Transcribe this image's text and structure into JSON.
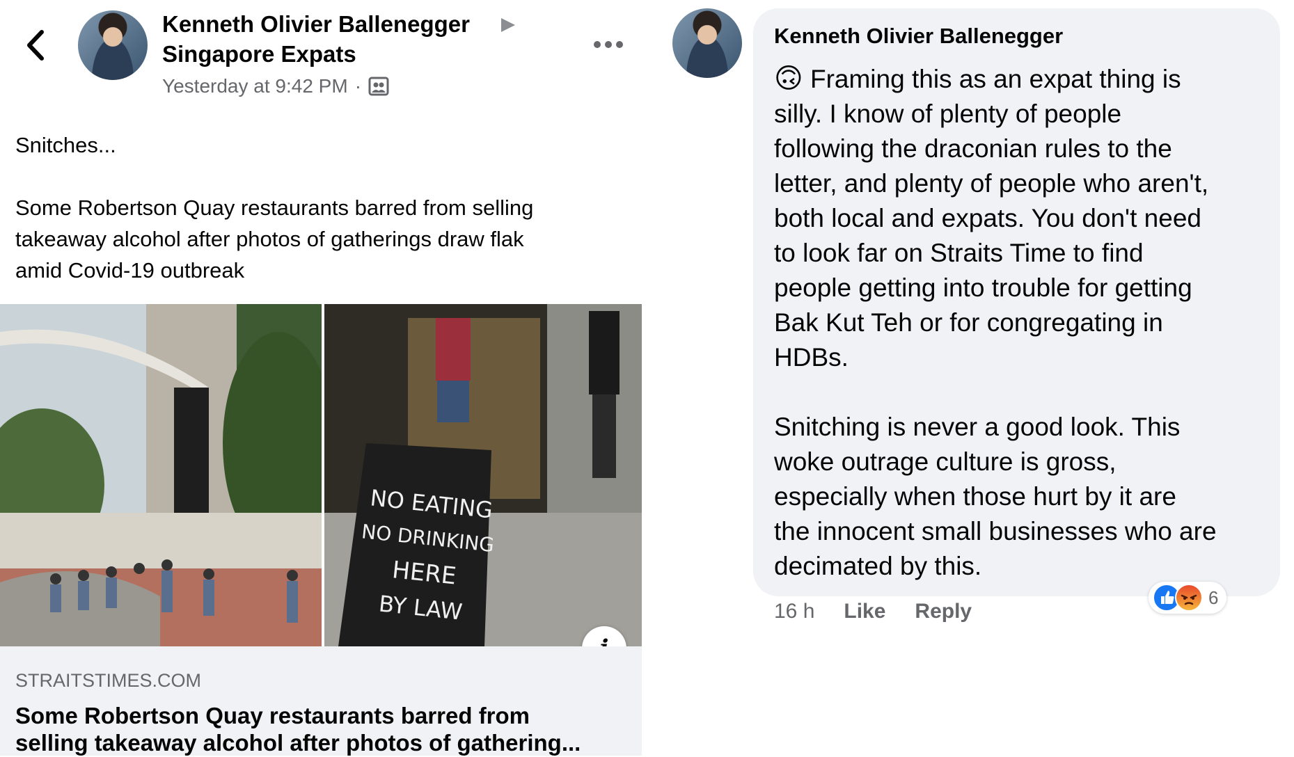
{
  "post": {
    "author": "Kenneth Olivier Ballenegger",
    "group": "Singapore Expats",
    "timestamp": "Yesterday at 9:42 PM",
    "separator": "·",
    "text_line1": "Snitches...",
    "text_lines": [
      "Some Robertson Quay restaurants barred from selling",
      "takeaway alcohol after photos of gatherings draw flak",
      "amid Covid-19 outbreak"
    ],
    "sign_lines": [
      "NO EATING",
      "NO DRINKING",
      "HERE",
      "BY LAW"
    ],
    "info_glyph": "i",
    "link": {
      "domain": "STRAITSTIMES.COM",
      "title_lines": [
        "Some Robertson Quay restaurants barred from",
        "selling takeaway alcohol after photos of gathering..."
      ]
    },
    "icons": {
      "back": "back-chevron-icon",
      "arrow": "right-triangle-icon",
      "more": "more-options-icon",
      "audience": "group-audience-icon",
      "info": "info-icon"
    }
  },
  "comment": {
    "author": "Kenneth Olivier Ballenegger",
    "emoji": "🙃",
    "paragraph1_lines": [
      "Framing this as an expat thing is",
      "silly. I know of plenty of people",
      "following the draconian rules to the",
      "letter, and plenty of people who aren't,",
      "both local and expats. You don't need",
      "to look far on Straits Time to find",
      "people getting into trouble for getting",
      "Bak Kut Teh or for congregating in",
      "HDBs."
    ],
    "paragraph2_lines": [
      "Snitching is never a good look. This",
      "woke outrage culture is gross,",
      "especially when those hurt by it are",
      "the innocent small businesses who are",
      "decimated by this."
    ],
    "time": "16 h",
    "like_label": "Like",
    "reply_label": "Reply",
    "reaction_count": "6",
    "colors": {
      "like_blue": "#1877f2",
      "angry_orange": "#f2792b"
    }
  }
}
